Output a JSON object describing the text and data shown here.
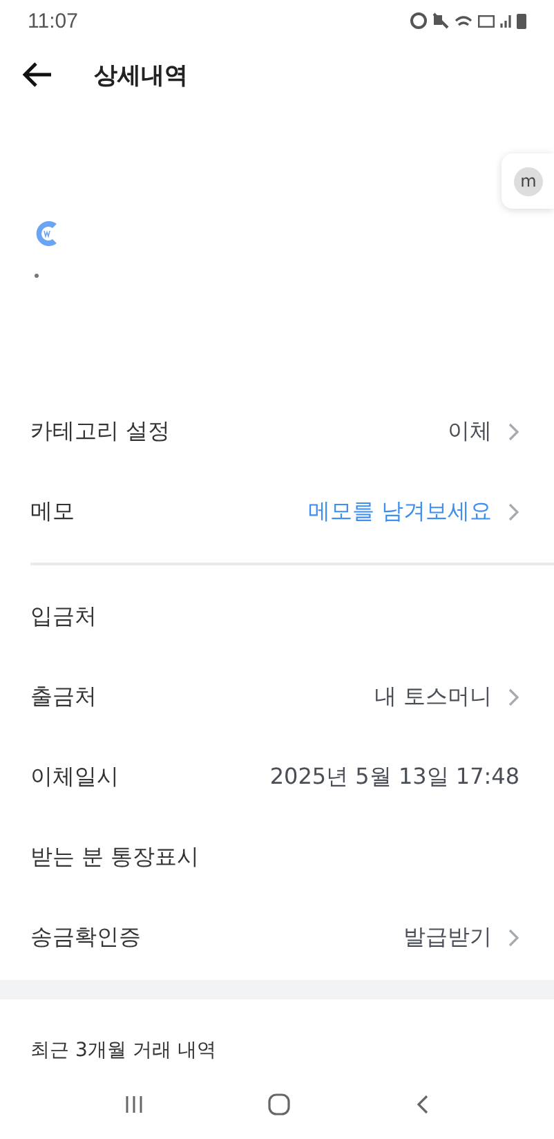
{
  "status_bar": {
    "time": "11:07"
  },
  "header": {
    "title": "상세내역"
  },
  "floating_button": {
    "label": "m"
  },
  "settings": [
    {
      "label": "카테고리 설정",
      "value": {
        "text": "이체",
        "highlighted": false
      },
      "chevron": true
    },
    {
      "label": "메모",
      "value": {
        "text": "메모를 남겨보세요",
        "highlighted": true
      },
      "chevron": true
    }
  ],
  "details": [
    {
      "label": "입금처",
      "chevron": false
    },
    {
      "label": "출금처",
      "value": {
        "text": "내 토스머니",
        "highlighted": false
      },
      "chevron": true
    },
    {
      "label": "이체일시",
      "value": {
        "text": "2025년 5월 13일 17:48",
        "highlighted": false
      },
      "chevron": false
    },
    {
      "label": "받는 분 통장표시",
      "chevron": false
    },
    {
      "label": "송금확인증",
      "value": {
        "text": "발급받기",
        "highlighted": false
      },
      "chevron": true
    }
  ],
  "recent": {
    "title": "최근 3개월 거래 내역"
  }
}
